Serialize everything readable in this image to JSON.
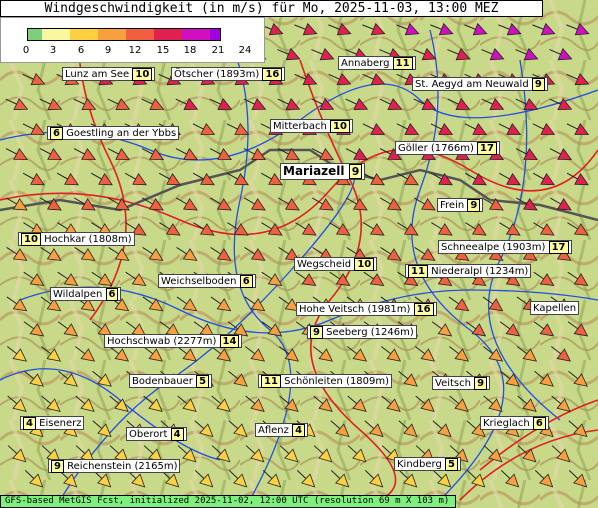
{
  "title": "Windgeschwindigkeit (in m/s) für Mo, 2025-11-03, 13:00 MEZ",
  "legend": {
    "ticks": [
      "0",
      "3",
      "6",
      "9",
      "12",
      "15",
      "18",
      "21",
      "24"
    ],
    "colors": [
      "#7cd07c",
      "#f8f8a0",
      "#fcd040",
      "#f8a040",
      "#f06040",
      "#e02050",
      "#d010c0",
      "#a000e0"
    ]
  },
  "stations": [
    {
      "name": "Lunz am See",
      "value": "10"
    },
    {
      "name": "Ötscher (1893m)",
      "value": "16"
    },
    {
      "name": "Annaberg",
      "value": "11"
    },
    {
      "name": "St. Aegyd am Neuwald",
      "value": "9"
    },
    {
      "name": "Goestling an der Ybbs",
      "value": "6"
    },
    {
      "name": "Mitterbach",
      "value": "10"
    },
    {
      "name": "Göller (1766m)",
      "value": "17"
    },
    {
      "name": "Mariazell",
      "value": "9"
    },
    {
      "name": "Frein",
      "value": "9"
    },
    {
      "name": "Hochkar (1808m)",
      "value": "10"
    },
    {
      "name": "Schneealpe (1903m)",
      "value": "17"
    },
    {
      "name": "Wegscheid",
      "value": "10"
    },
    {
      "name": "Niederalpl (1234m)",
      "value": "11"
    },
    {
      "name": "Weichselboden",
      "value": "6"
    },
    {
      "name": "Wildalpen",
      "value": "6"
    },
    {
      "name": "Hohe Veitsch (1981m)",
      "value": "16"
    },
    {
      "name": "Kapellen",
      "value": ""
    },
    {
      "name": "Seeberg (1246m)",
      "value": "9"
    },
    {
      "name": "Hochschwab (2277m)",
      "value": "14"
    },
    {
      "name": "Bodenbauer",
      "value": "5"
    },
    {
      "name": "Schönleiten (1809m)",
      "value": "11"
    },
    {
      "name": "Veitsch",
      "value": "9"
    },
    {
      "name": "Eisenerz",
      "value": "4"
    },
    {
      "name": "Aflenz",
      "value": "4"
    },
    {
      "name": "Oberort",
      "value": "4"
    },
    {
      "name": "Krieglach",
      "value": "6"
    },
    {
      "name": "Reichenstein (2165m)",
      "value": "9"
    },
    {
      "name": "Kindberg",
      "value": "5"
    }
  ],
  "footer": "GFS-based MetGIS Fcst, initialized 2025-11-02, 12:00 UTC  (resolution 69 m X 103 m)"
}
